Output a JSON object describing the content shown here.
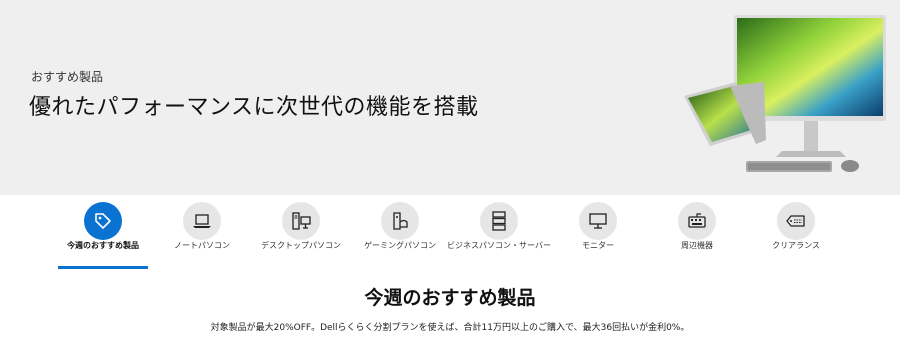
{
  "hero": {
    "eyebrow": "おすすめ製品",
    "title": "優れたパフォーマンスに次世代の機能を搭載"
  },
  "categories": [
    {
      "label": "今週のおすすめ製品",
      "icon": "tag-icon",
      "active": true
    },
    {
      "label": "ノートパソコン",
      "icon": "laptop-icon",
      "active": false
    },
    {
      "label": "デスクトップパソコン",
      "icon": "desktop-icon",
      "active": false
    },
    {
      "label": "ゲーミングパソコン",
      "icon": "gaming-pc-icon",
      "active": false
    },
    {
      "label": "ビジネスパソコン・サーバー",
      "icon": "server-icon",
      "active": false
    },
    {
      "label": "モニター",
      "icon": "monitor-icon",
      "active": false
    },
    {
      "label": "周辺機器",
      "icon": "keyboard-icon",
      "active": false
    },
    {
      "label": "クリアランス",
      "icon": "clearance-tag-icon",
      "active": false
    }
  ],
  "section": {
    "title": "今週のおすすめ製品",
    "subtitle": "対象製品が最大20%OFF。Dellらくらく分割プランを使えば、合計11万円以上のご購入で、最大36回払いが金利0%。"
  },
  "colors": {
    "accent": "#0a72d1",
    "hero_bg": "#efefef",
    "icon_bg": "#e6e6e6"
  }
}
